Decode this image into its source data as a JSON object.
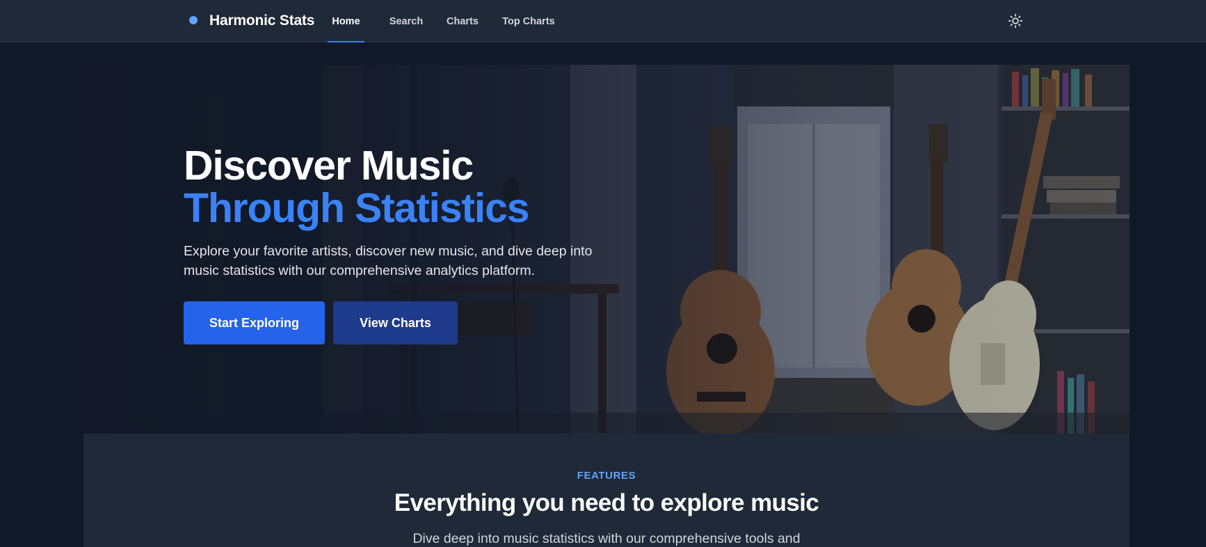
{
  "nav": {
    "brand": "Harmonic Stats",
    "links": [
      {
        "label": "Home",
        "active": true
      },
      {
        "label": "Search",
        "active": false
      },
      {
        "label": "Charts",
        "active": false
      },
      {
        "label": "Top Charts",
        "active": false
      }
    ],
    "theme_icon": "sun-icon"
  },
  "hero": {
    "title_line1": "Discover Music",
    "title_line2": "Through Statistics",
    "subtitle": "Explore your favorite artists, discover new music, and dive deep into music statistics with our comprehensive analytics platform.",
    "primary_button": "Start Exploring",
    "secondary_button": "View Charts"
  },
  "features": {
    "eyebrow": "FEATURES",
    "title": "Everything you need to explore music",
    "subtitle": "Dive deep into music statistics with our comprehensive tools and"
  },
  "colors": {
    "accent": "#3b82f6",
    "primary_button": "#2563eb",
    "secondary_button": "#1e3a8a",
    "background": "#111827",
    "surface": "#1f2937"
  }
}
